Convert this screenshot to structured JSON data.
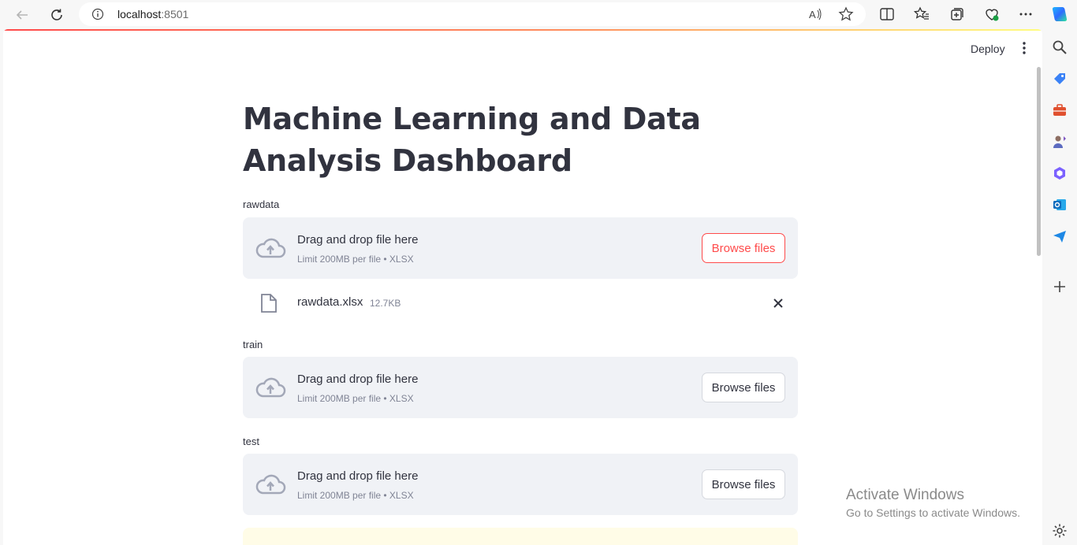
{
  "browser": {
    "url_host": "localhost",
    "url_port": ":8501"
  },
  "app": {
    "deploy_label": "Deploy",
    "title": "Machine Learning and Data Analysis Dashboard"
  },
  "uploaders": [
    {
      "label": "rawdata",
      "drop_title": "Drag and drop file here",
      "limit": "Limit 200MB per file • XLSX",
      "button": "Browse files",
      "file": {
        "name": "rawdata.xlsx",
        "size": "12.7KB"
      }
    },
    {
      "label": "train",
      "drop_title": "Drag and drop file here",
      "limit": "Limit 200MB per file • XLSX",
      "button": "Browse files"
    },
    {
      "label": "test",
      "drop_title": "Drag and drop file here",
      "limit": "Limit 200MB per file • XLSX",
      "button": "Browse files"
    }
  ],
  "overlay": {
    "activate_title": "Activate Windows",
    "activate_sub": "Go to Settings to activate Windows."
  },
  "colors": {
    "accent": "#ff4b4b",
    "dropzone_bg": "#f0f2f6",
    "text": "#31333f",
    "muted": "#808495"
  }
}
